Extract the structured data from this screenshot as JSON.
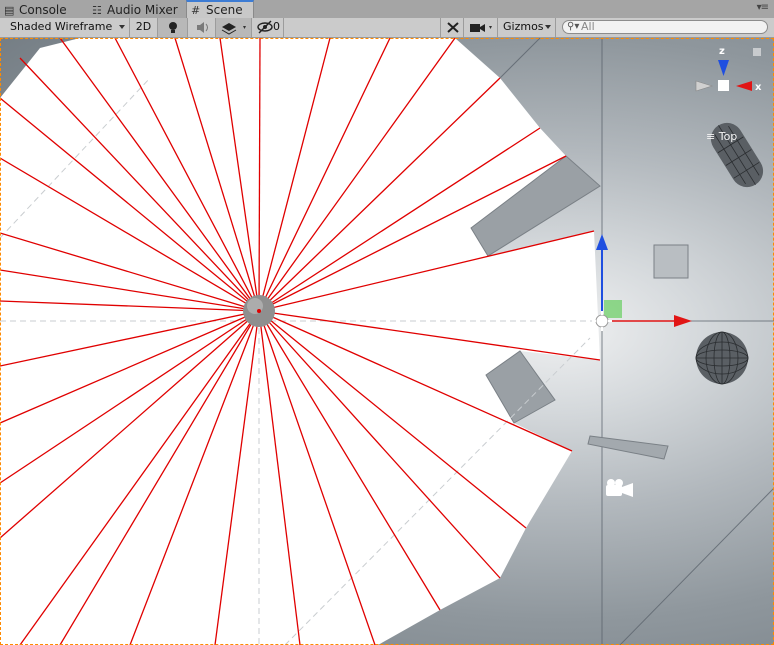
{
  "tabs": [
    {
      "label": "Console",
      "icon": "console-icon"
    },
    {
      "label": "Audio Mixer",
      "icon": "audio-mixer-icon"
    },
    {
      "label": "Scene",
      "icon": "scene-grid-icon"
    }
  ],
  "toolbar": {
    "draw_mode": "Shaded Wireframe",
    "mode_2d": "2D",
    "hidden_count": "0",
    "gizmos": "Gizmos",
    "search_placeholder": "All"
  },
  "gizmo": {
    "z_label": "z",
    "x_label": "x",
    "view_label": "Top"
  },
  "colors": {
    "accent": "#3d7cd4",
    "selection_outline": "#ff8a00",
    "ray": "#e00000",
    "axis_x": "#e11515",
    "axis_z": "#1f4fe0",
    "axis_y": "#46c83b"
  }
}
